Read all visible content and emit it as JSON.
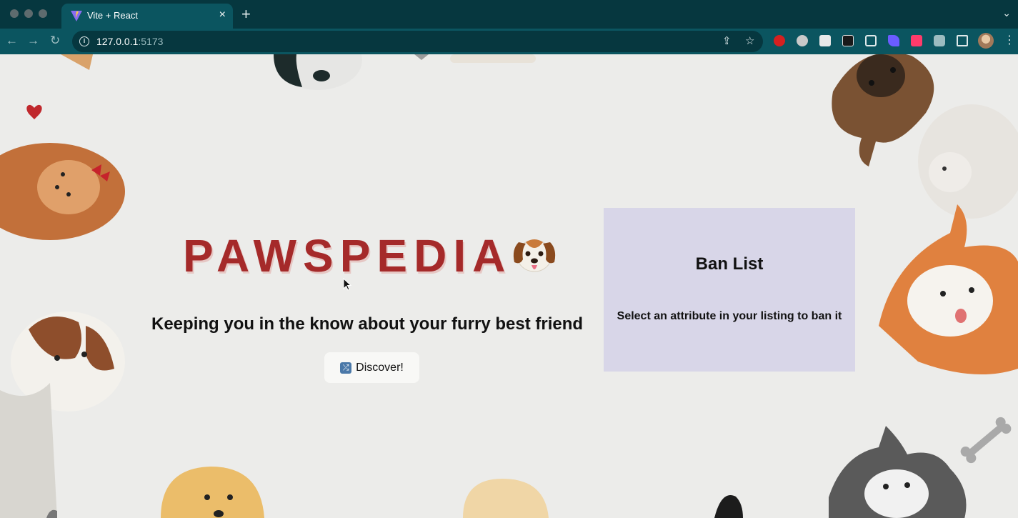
{
  "browser": {
    "tab": {
      "title": "Vite + React",
      "close": "×"
    },
    "new_tab": "+",
    "tab_search": "⌄",
    "nav": {
      "back": "←",
      "forward": "→",
      "reload": "↻"
    },
    "url": {
      "host": "127.0.0.1",
      "port": ":5173"
    },
    "omnibox_icons": {
      "share": "⇪",
      "bookmark": "☆"
    },
    "menu": "⋮"
  },
  "page": {
    "title": "PAWSPEDIA",
    "tagline": "Keeping you in the know about your furry best friend",
    "discover_button": {
      "icon": "⤮",
      "label": "Discover!"
    },
    "ban_list": {
      "title": "Ban List",
      "subtitle": "Select an attribute in your listing to ban it"
    }
  },
  "colors": {
    "chrome_dark": "#06373f",
    "chrome_tab": "#0b5560",
    "title_red": "#a52a2a",
    "page_bg": "#ececea",
    "ban_panel": "#d8d6e8"
  }
}
